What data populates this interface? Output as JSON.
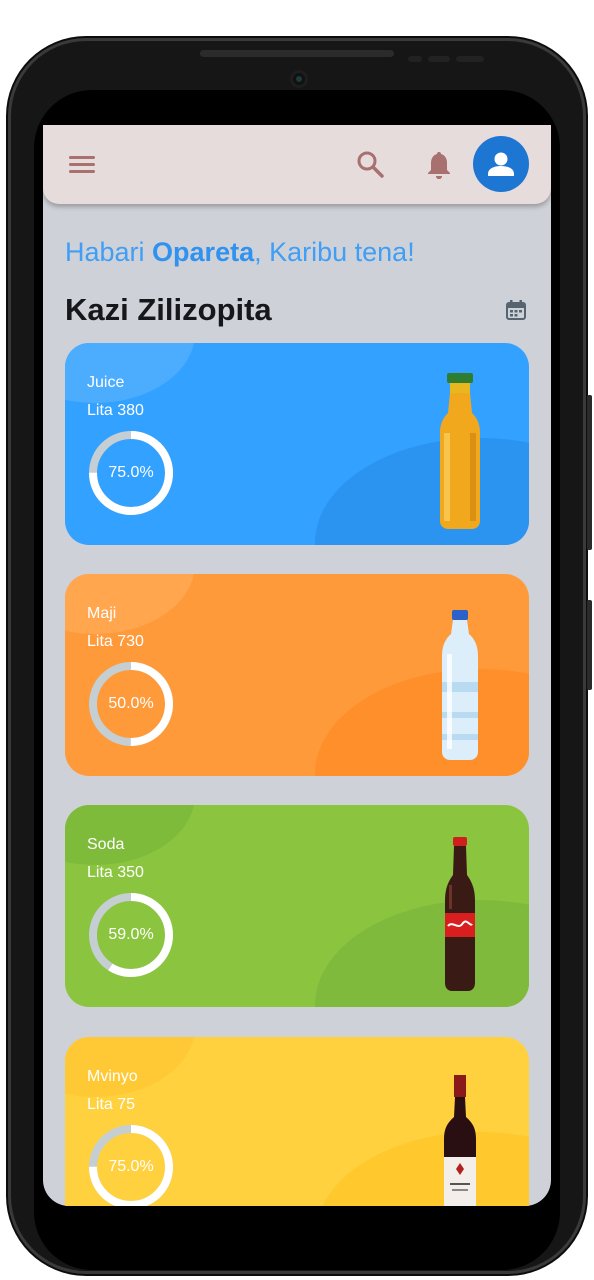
{
  "header": {
    "menu_icon": "menu-icon",
    "search_icon": "search-icon",
    "bell_icon": "bell-icon",
    "profile_icon": "person-icon"
  },
  "greeting": {
    "prefix": "Habari ",
    "name": "Opareta",
    "suffix": ", Karibu tena!"
  },
  "section": {
    "title": "Kazi Zilizopita",
    "calendar_icon": "calendar-icon"
  },
  "colors": {
    "juice": "#33a1ff",
    "maji": "#ff9a3b",
    "soda": "#8bc540",
    "mvinyo": "#ffd13f",
    "ring_track": "#c5ced2",
    "ring_fill": "#ffffff"
  },
  "cards": [
    {
      "name": "Juice",
      "litres": "Lita 380",
      "percent_label": "75.0%",
      "percent": 75.0,
      "image": "juice-bottle"
    },
    {
      "name": "Maji",
      "litres": "Lita 730",
      "percent_label": "50.0%",
      "percent": 50.0,
      "image": "water-bottle"
    },
    {
      "name": "Soda",
      "litres": "Lita 350",
      "percent_label": "59.0%",
      "percent": 59.0,
      "image": "cola-bottle"
    },
    {
      "name": "Mvinyo",
      "litres": "Lita 75",
      "percent_label": "75.0%",
      "percent": 75.0,
      "image": "wine-bottle"
    }
  ]
}
